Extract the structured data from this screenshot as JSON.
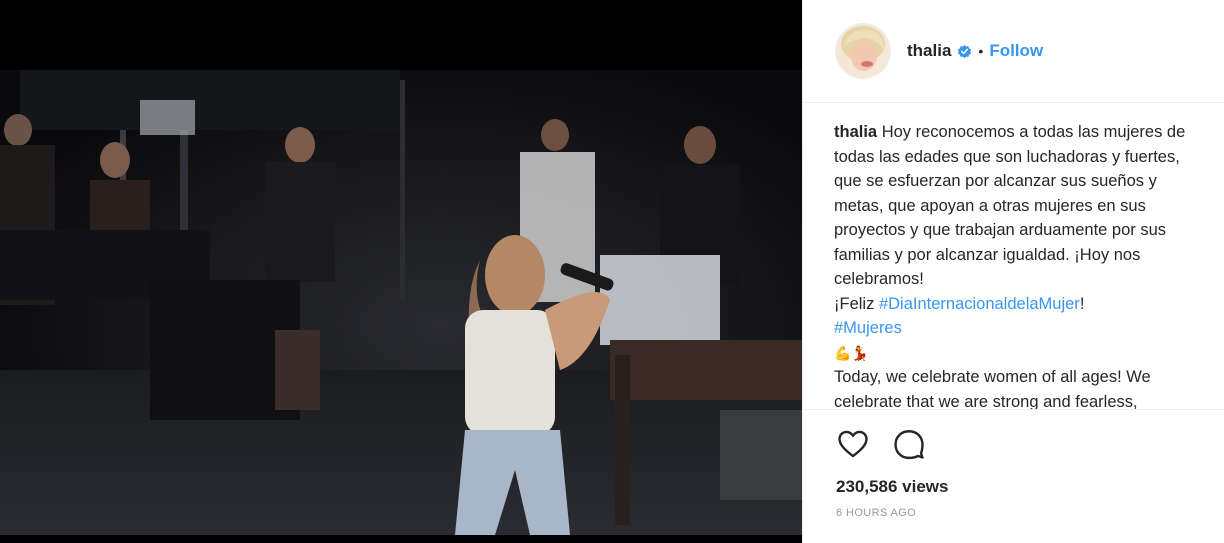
{
  "post": {
    "username": "thalia",
    "separator": "•",
    "follow_label": "Follow",
    "caption": {
      "username": "thalia",
      "text_es": "Hoy reconocemos a todas las mujeres de todas las edades que son luchadoras y fuertes, que se esfuerzan por alcanzar sus sueños y metas, que apoyan a otras mujeres en sus proyectos y que trabajan arduamente por sus familias y por alcanzar igualdad. ¡Hoy nos celebramos!",
      "feliz": "¡Feliz",
      "hashtag1": "#DiaInternacionaldelaMujer",
      "exclaim": "!",
      "hashtag2": "#Mujeres",
      "emojis": "💪💃",
      "text_en": "Today, we celebrate women of all ages! We celebrate that we are strong and fearless,"
    },
    "views": "230,586 views",
    "time": "6 HOURS AGO"
  },
  "icons": {
    "verified": "verified-badge-icon",
    "like": "heart-icon",
    "comment": "comment-icon"
  },
  "colors": {
    "link": "#3897f0",
    "text": "#262626",
    "muted": "#999999"
  }
}
